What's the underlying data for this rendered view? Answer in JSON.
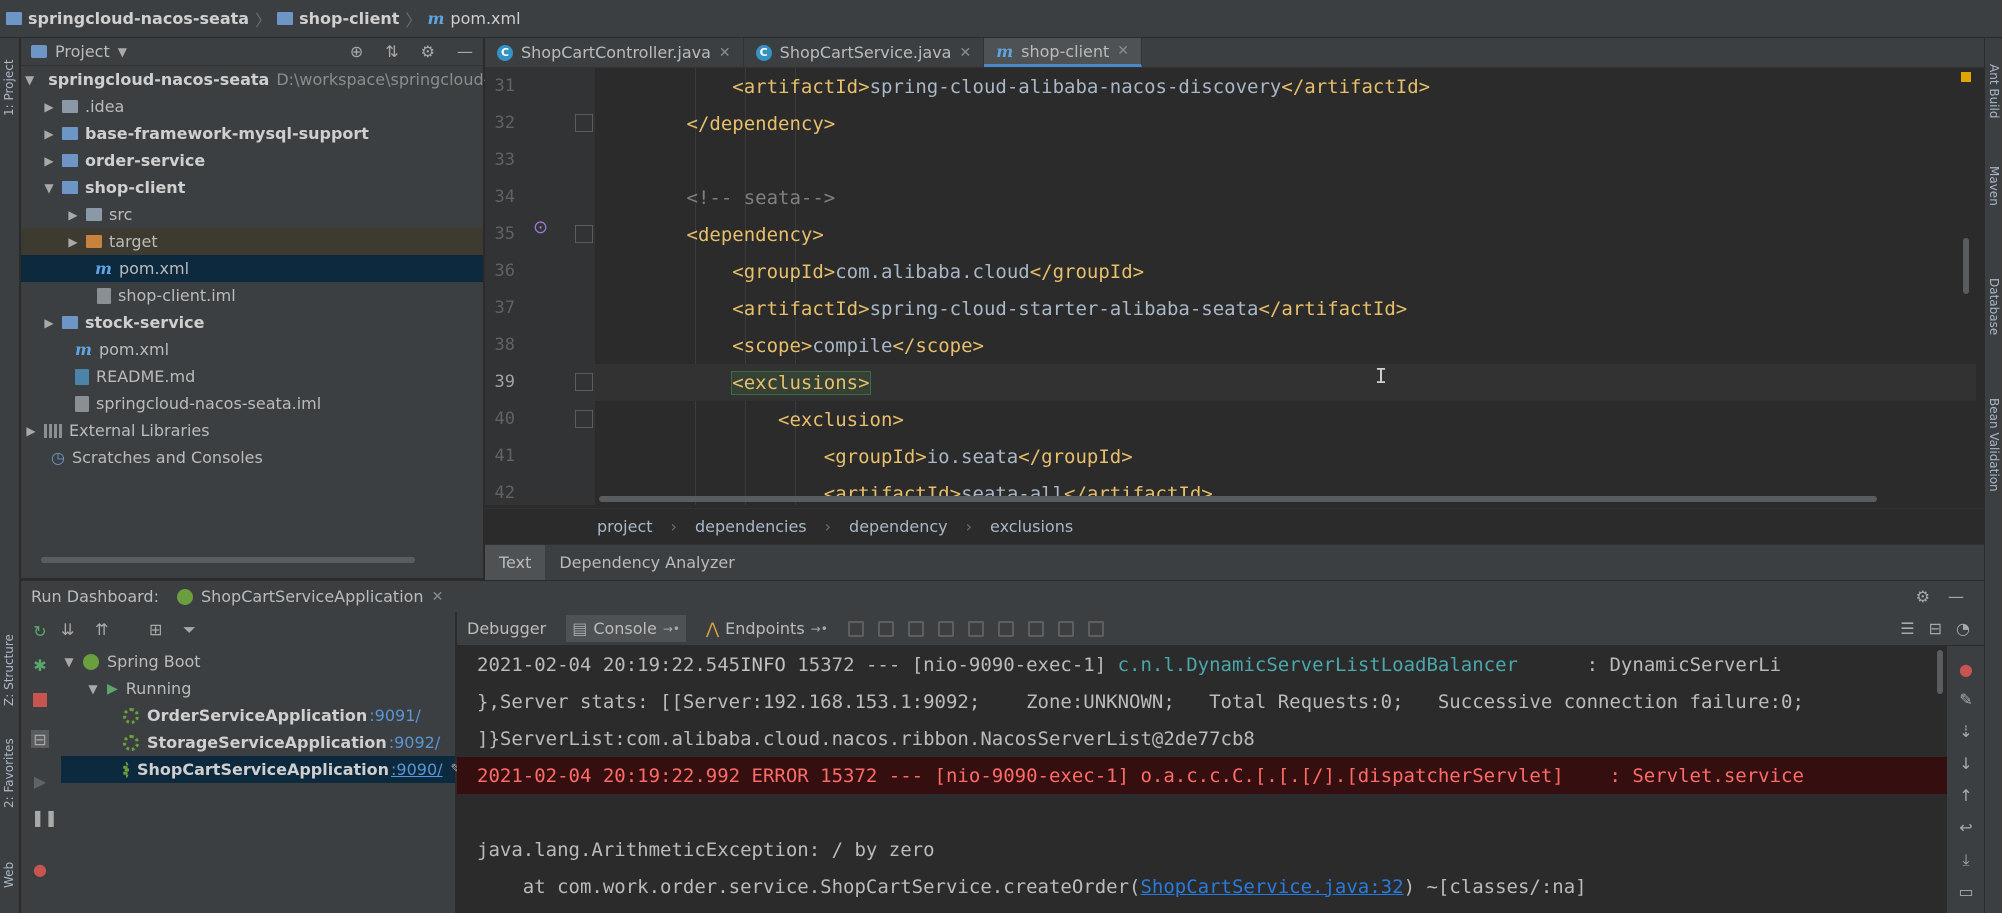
{
  "navbar": {
    "crumbs": [
      "springcloud-nacos-seata",
      "shop-client",
      "pom.xml"
    ]
  },
  "left_strip": {
    "project": "1: Project",
    "structure": "Z: Structure",
    "favorites": "2: Favorites",
    "web": "Web"
  },
  "right_strip": {
    "ant": "Ant Build",
    "maven": "Maven",
    "database": "Database",
    "bean": "Bean Validation"
  },
  "project_panel": {
    "title": "Project",
    "items": [
      {
        "label": "springcloud-nacos-seata",
        "hint": "D:\\workspace\\springcloud-",
        "arrow": "▼"
      },
      {
        "label": ".idea",
        "arrow": "▶"
      },
      {
        "label": "base-framework-mysql-support",
        "arrow": "▶"
      },
      {
        "label": "order-service",
        "arrow": "▶"
      },
      {
        "label": "shop-client",
        "arrow": "▼"
      },
      {
        "label": "src",
        "arrow": "▶"
      },
      {
        "label": "target",
        "arrow": "▶"
      },
      {
        "label": "pom.xml"
      },
      {
        "label": "shop-client.iml"
      },
      {
        "label": "stock-service",
        "arrow": "▶"
      },
      {
        "label": "pom.xml"
      },
      {
        "label": "README.md"
      },
      {
        "label": "springcloud-nacos-seata.iml"
      },
      {
        "label": "External Libraries",
        "arrow": "▶"
      },
      {
        "label": "Scratches and Consoles"
      }
    ]
  },
  "editor": {
    "tabs": [
      {
        "label": "ShopCartController.java",
        "icon": "C"
      },
      {
        "label": "ShopCartService.java",
        "icon": "C"
      },
      {
        "label": "shop-client",
        "icon": "m"
      }
    ],
    "lines": [
      {
        "num": "31",
        "indent": "            ",
        "open": "<artifactId>",
        "text": "spring-cloud-alibaba-nacos-discovery",
        "close": "</artifactId>"
      },
      {
        "num": "32",
        "indent": "        ",
        "open": "",
        "text": "",
        "close": "</dependency>"
      },
      {
        "num": "33",
        "indent": "",
        "open": "",
        "text": "",
        "close": ""
      },
      {
        "num": "34",
        "indent": "        ",
        "comment": "<!-- seata-->"
      },
      {
        "num": "35",
        "indent": "        ",
        "open": "<dependency>",
        "text": "",
        "close": ""
      },
      {
        "num": "36",
        "indent": "            ",
        "open": "<groupId>",
        "text": "com.alibaba.cloud",
        "close": "</groupId>"
      },
      {
        "num": "37",
        "indent": "            ",
        "open": "<artifactId>",
        "text": "spring-cloud-starter-alibaba-seata",
        "close": "</artifactId>"
      },
      {
        "num": "38",
        "indent": "            ",
        "open": "<scope>",
        "text": "compile",
        "close": "</scope>"
      },
      {
        "num": "39",
        "indent": "            ",
        "open": "<exclusions>",
        "text": "",
        "close": ""
      },
      {
        "num": "40",
        "indent": "                ",
        "open": "<exclusion>",
        "text": "",
        "close": ""
      },
      {
        "num": "41",
        "indent": "                    ",
        "open": "<groupId>",
        "text": "io.seata",
        "close": "</groupId>"
      },
      {
        "num": "42",
        "indent": "                    ",
        "open": "<artifactId>",
        "text": "seata-all",
        "close": "</artifactId>"
      }
    ],
    "breadcrumb": [
      "project",
      "dependencies",
      "dependency",
      "exclusions"
    ],
    "subtabs": [
      "Text",
      "Dependency Analyzer"
    ]
  },
  "run_dashboard": {
    "label": "Run Dashboard:",
    "app_tab": "ShopCartServiceApplication",
    "tree": {
      "root": "Spring Boot",
      "group": "Running",
      "apps": [
        {
          "name": "OrderServiceApplication",
          "port": ":9091/"
        },
        {
          "name": "StorageServiceApplication",
          "port": ":9092/"
        },
        {
          "name": "ShopCartServiceApplication",
          "port": ":9090/"
        }
      ]
    },
    "console_tabs": {
      "debugger": "Debugger",
      "console": "Console",
      "endpoints": "Endpoints"
    },
    "console": {
      "l1": {
        "ts": "2021-02-04 20:19:22.545",
        "level": "INFO",
        "rest": " 15372 --- [nio-9090-exec-1] ",
        "logger": "c.n.l.DynamicServerListLoadBalancer",
        "msg": "      : DynamicServerLi"
      },
      "l2": "},Server stats: [[Server:192.168.153.1:9092;    Zone:UNKNOWN;   Total Requests:0;   Successive connection failure:0;",
      "l3": "]}ServerList:com.alibaba.cloud.nacos.ribbon.NacosServerList@2de77cb8",
      "l4": "2021-02-04 20:19:22.992 ERROR 15372 --- [nio-9090-exec-1] o.a.c.c.C.[.[.[/].[dispatcherServlet]    : Servlet.service",
      "l5": "",
      "l6": "java.lang.ArithmeticException: / by zero",
      "l7_pre": "    at com.work.order.service.ShopCartService.createOrder(",
      "l7_link": "ShopCartService.java:32",
      "l7_post": ") ~[classes/:na]"
    }
  }
}
